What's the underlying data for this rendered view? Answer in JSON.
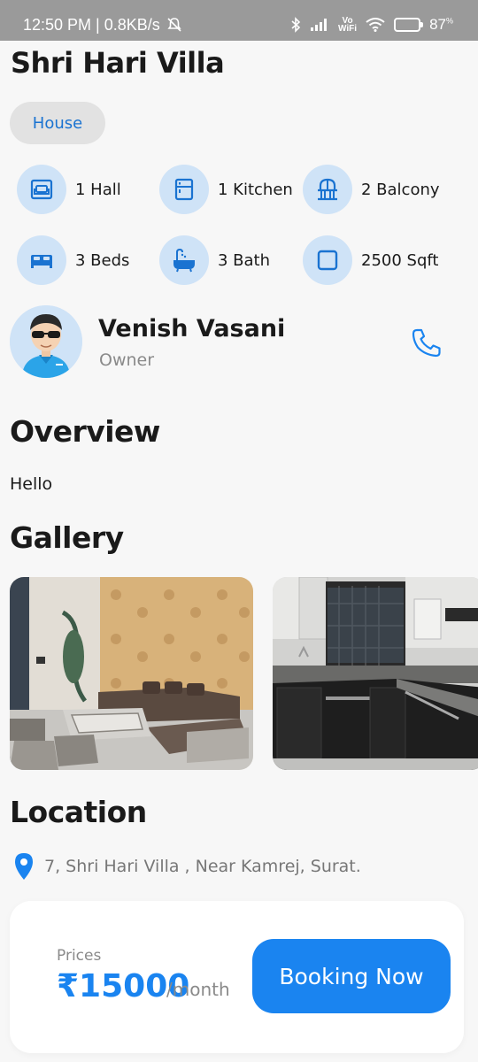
{
  "status_bar": {
    "time_network": "12:50 PM | 0.8KB/s",
    "vowifi_top": "Vo",
    "vowifi_bottom": "WiFi",
    "battery": "87",
    "battery_percent": 0.87
  },
  "property": {
    "title": "Shri Hari Villa",
    "type_chip": "House"
  },
  "features": [
    {
      "label": "1 Hall",
      "icon": "sofa-icon"
    },
    {
      "label": "1 Kitchen",
      "icon": "fridge-icon"
    },
    {
      "label": "2 Balcony",
      "icon": "balcony-icon"
    },
    {
      "label": "3 Beds",
      "icon": "bed-icon"
    },
    {
      "label": "3 Bath",
      "icon": "bathtub-icon"
    },
    {
      "label": "2500 Sqft",
      "icon": "area-icon"
    }
  ],
  "owner": {
    "name": "Venish Vasani",
    "role": "Owner"
  },
  "overview": {
    "heading": "Overview",
    "text": "Hello"
  },
  "gallery": {
    "heading": "Gallery",
    "images": [
      "living-room-photo",
      "kitchen-photo"
    ]
  },
  "location": {
    "heading": "Location",
    "address": "7, Shri Hari Villa , Near Kamrej, Surat."
  },
  "booking": {
    "price_label": "Prices",
    "price": "₹15000",
    "unit": "/month",
    "button_label": "Booking Now"
  },
  "colors": {
    "accent": "#1a84f0",
    "icon_bg": "#cfe3f7"
  }
}
